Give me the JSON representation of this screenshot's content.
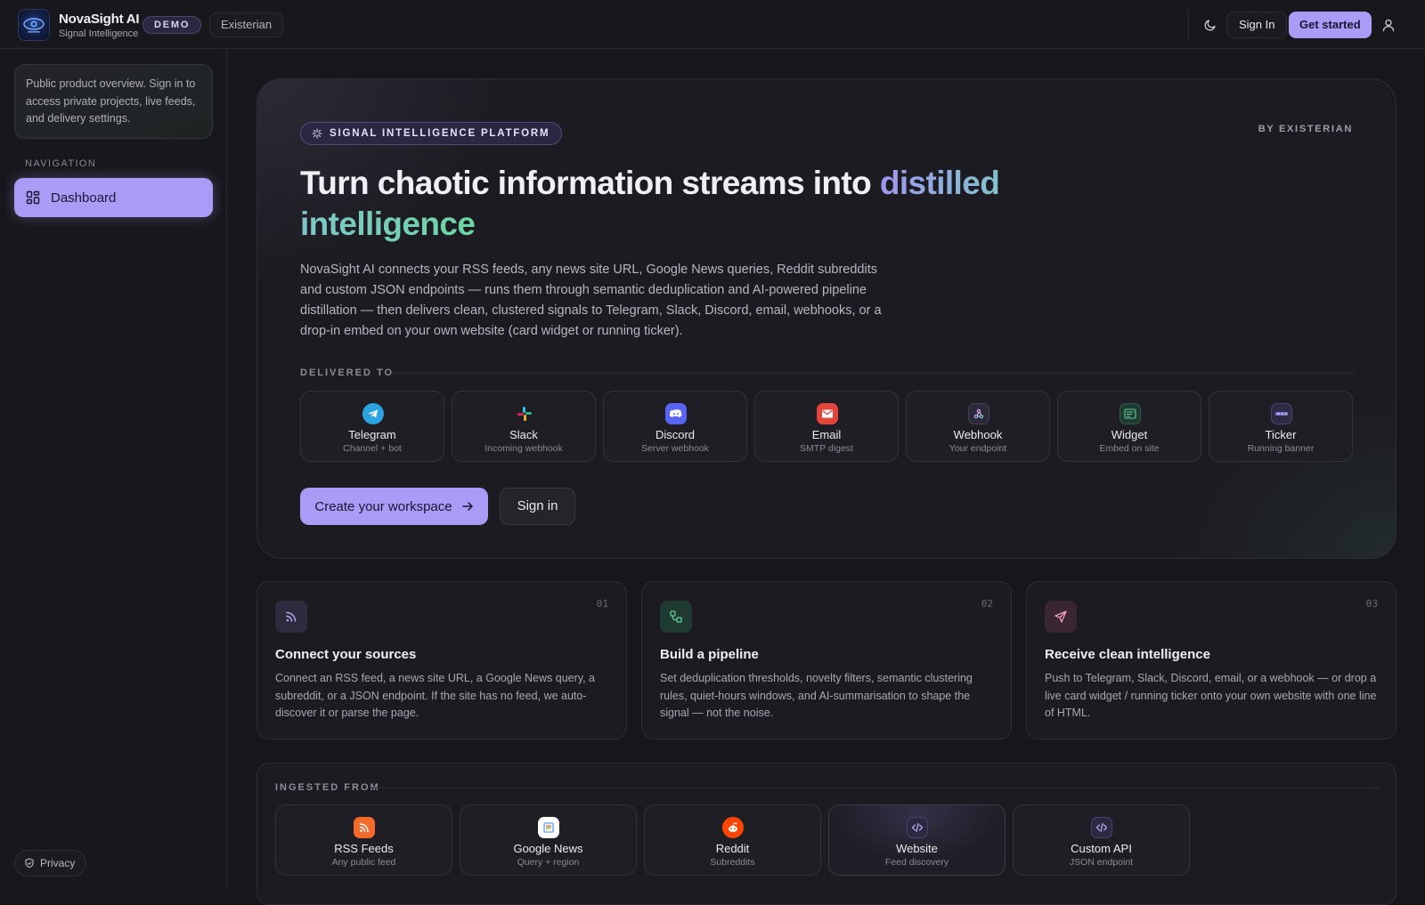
{
  "header": {
    "app_name": "NovaSight AI",
    "app_subtitle": "Signal Intelligence",
    "badge": "DEMO",
    "org": "Existerian",
    "sign_in": "Sign In",
    "get_started": "Get started",
    "icons": [
      "moon-icon",
      "user-icon"
    ]
  },
  "sidebar": {
    "notice": "Public product overview. Sign in to access private projects, live feeds, and delivery settings.",
    "nav_label": "NAVIGATION",
    "items": [
      {
        "label": "Dashboard",
        "icon": "dashboard-icon",
        "active": true
      }
    ],
    "privacy": "Privacy"
  },
  "hero": {
    "pill": "SIGNAL INTELLIGENCE PLATFORM",
    "by_line": "BY EXISTERIAN",
    "headline_plain": "Turn chaotic information streams into ",
    "headline_accent": "distilled intelligence",
    "description": "NovaSight AI connects your RSS feeds, any news site URL, Google News queries, Reddit subreddits and custom JSON endpoints — runs them through semantic deduplication and AI-powered pipeline distillation — then delivers clean, clustered signals to Telegram, Slack, Discord, email, webhooks, or a drop-in embed on your own website (card widget or running ticker).",
    "delivered_label": "DELIVERED TO",
    "channels": [
      {
        "name": "Telegram",
        "sub": "Channel + bot"
      },
      {
        "name": "Slack",
        "sub": "Incoming webhook"
      },
      {
        "name": "Discord",
        "sub": "Server webhook"
      },
      {
        "name": "Email",
        "sub": "SMTP digest"
      },
      {
        "name": "Webhook",
        "sub": "Your endpoint"
      },
      {
        "name": "Widget",
        "sub": "Embed on site"
      },
      {
        "name": "Ticker",
        "sub": "Running banner"
      }
    ],
    "cta_primary": "Create your workspace",
    "cta_secondary": "Sign in"
  },
  "steps": [
    {
      "num": "01",
      "title": "Connect your sources",
      "body": "Connect an RSS feed, a news site URL, a Google News query, a subreddit, or a JSON endpoint. If the site has no feed, we auto-discover it or parse the page."
    },
    {
      "num": "02",
      "title": "Build a pipeline",
      "body": "Set deduplication thresholds, novelty filters, semantic clustering rules, quiet-hours windows, and AI-summarisation to shape the signal — not the noise."
    },
    {
      "num": "03",
      "title": "Receive clean intelligence",
      "body": "Push to Telegram, Slack, Discord, email, or a webhook — or drop a live card widget / running ticker onto your own website with one line of HTML."
    }
  ],
  "ingest": {
    "label": "INGESTED FROM",
    "sources": [
      {
        "name": "RSS Feeds",
        "sub": "Any public feed"
      },
      {
        "name": "Google News",
        "sub": "Query + region"
      },
      {
        "name": "Reddit",
        "sub": "Subreddits"
      },
      {
        "name": "Website",
        "sub": "Feed discovery"
      },
      {
        "name": "Custom API",
        "sub": "JSON endpoint"
      }
    ]
  },
  "colors": {
    "accent": "#a99bf6",
    "background": "#17161b",
    "card": "#1c1b21"
  }
}
